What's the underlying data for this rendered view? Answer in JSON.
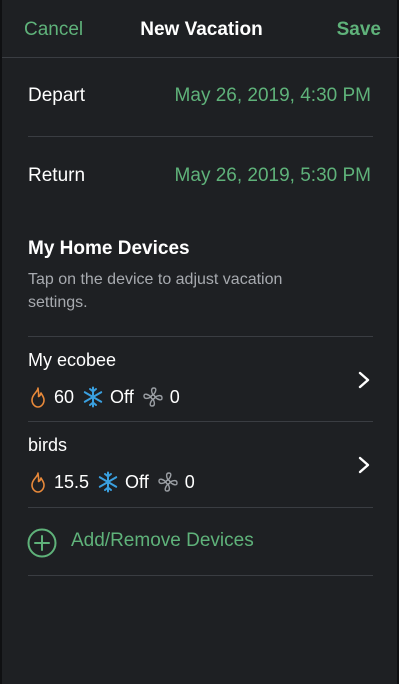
{
  "header": {
    "cancel_label": "Cancel",
    "title": "New Vacation",
    "save_label": "Save"
  },
  "schedule": {
    "depart_label": "Depart",
    "depart_value": "May 26, 2019, 4:30 PM",
    "return_label": "Return",
    "return_value": "May 26, 2019, 5:30 PM"
  },
  "devices_section": {
    "title": "My Home Devices",
    "description": "Tap on the device to adjust vacation settings."
  },
  "devices": [
    {
      "name": "My ecobee",
      "heat_setpoint": "60",
      "cool_mode": "Off",
      "fan_value": "0"
    },
    {
      "name": "birds",
      "heat_setpoint": "15.5",
      "cool_mode": "Off",
      "fan_value": "0"
    }
  ],
  "add_remove_label": "Add/Remove Devices",
  "icons": {
    "heat": "flame-icon",
    "cool": "snowflake-icon",
    "fan": "fan-icon",
    "chevron": "chevron-right-icon",
    "add": "plus-circle-icon"
  },
  "colors": {
    "accent_green": "#5fb27a",
    "heat_orange": "#e8893a",
    "cool_blue": "#3aa0e0",
    "fan_grey": "#9a9ea3",
    "background": "#1e2023"
  }
}
